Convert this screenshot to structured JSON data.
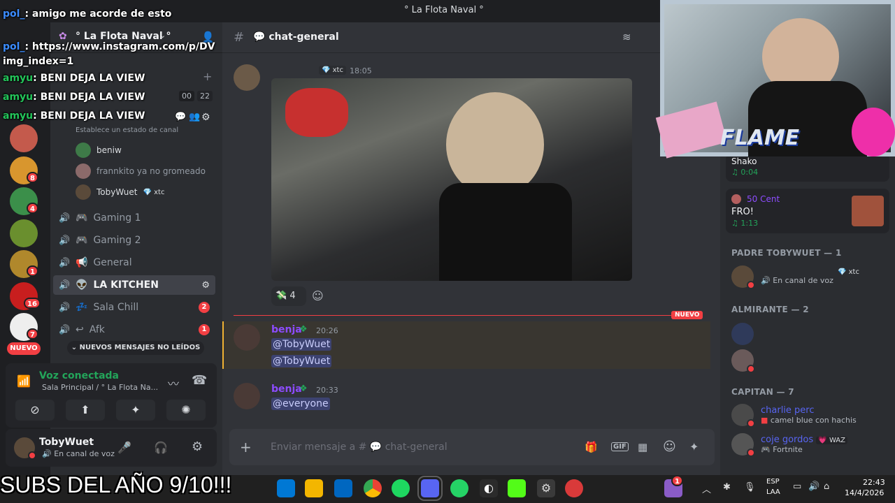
{
  "window": {
    "title": "° La Flota Naval °"
  },
  "servers": {
    "badges": [
      "8",
      "4",
      "1",
      "16",
      "7"
    ],
    "new_label": "NUEVO"
  },
  "sidebar": {
    "server_name": "° La Flota Naval °",
    "status_hint": "Establece un estado de canal",
    "counter_left": "00",
    "counter_right": "22",
    "voice_users": [
      {
        "name": "beniw"
      },
      {
        "name": "frannkito ya no gromeado"
      },
      {
        "name": "TobyWuet",
        "tag": "xtc"
      }
    ],
    "channels": [
      {
        "name": "Gaming 1",
        "emoji": "🎮"
      },
      {
        "name": "Gaming 2",
        "emoji": "🎮"
      },
      {
        "name": "General",
        "emoji": "📢"
      },
      {
        "name": "LA KITCHEN",
        "emoji": "👽"
      },
      {
        "name": "Sala Chill",
        "emoji": "💤",
        "badge": "2"
      },
      {
        "name": "Afk",
        "emoji": "↩",
        "badge": "1"
      }
    ],
    "unread_bar": "NUEVOS MENSAJES NO LEÍDOS"
  },
  "voice": {
    "status": "Voz conectada",
    "location": "Sala Principal / ° La Flota Na..."
  },
  "user": {
    "name": "TobyWuet",
    "status": "En canal de voz"
  },
  "chat": {
    "channel": "chat-general",
    "first": {
      "tag": "xtc",
      "time": "18:05",
      "reaction_count": "4"
    },
    "new_divider": "NUEVO",
    "messages": [
      {
        "author": "benja",
        "time": "20:26",
        "lines": [
          "@TobyWuet",
          "@TobyWuet"
        ]
      },
      {
        "author": "benja",
        "time": "20:33",
        "lines": [
          "@everyone"
        ]
      }
    ],
    "composer_placeholder": "Enviar mensaje a # 💬 chat-general"
  },
  "members": {
    "activities": [
      {
        "name": "Shako",
        "time": "0:04"
      },
      {
        "user": "50 Cent",
        "name": "FRO!",
        "time": "1:13"
      }
    ],
    "groups": [
      {
        "label": "PADRE TOBYWUET — 1",
        "members": [
          {
            "tag": "xtc",
            "status": "En canal de voz"
          }
        ]
      },
      {
        "label": "ALMIRANTE — 2"
      },
      {
        "label": "CAPITAN — 7",
        "members": [
          {
            "name": "charlie perc",
            "status": "camel blue con hachis"
          },
          {
            "name": "coje gordos",
            "tag": "WAZ",
            "status": "Fortnite"
          }
        ]
      }
    ]
  },
  "overlay": {
    "lines": [
      {
        "user": "pol_",
        "text": ": amigo me acorde de esto"
      },
      {
        "user": "pol_",
        "text": ": https://www.instagram.com/p/DV"
      },
      {
        "user": "",
        "text": "img_index=1"
      },
      {
        "user": "amyu",
        "text": ": BENI DEJA LA VIEW"
      },
      {
        "user": "amyu",
        "text": ": BENI DEJA LA VIEW"
      },
      {
        "user": "amyu",
        "text": ": BENI DEJA LA VIEW"
      }
    ],
    "caption": "SUBS DEL AÑO 9/10!!!",
    "flame": "FLAME"
  },
  "taskbar": {
    "lang": "ESP",
    "layout": "LAA",
    "time": "22:43",
    "date": "14/4/2026",
    "notif": "1"
  },
  "colors": {
    "accent": "#5865f2",
    "mention": "#c9cdfb",
    "danger": "#f23f43",
    "online": "#23a55a"
  }
}
